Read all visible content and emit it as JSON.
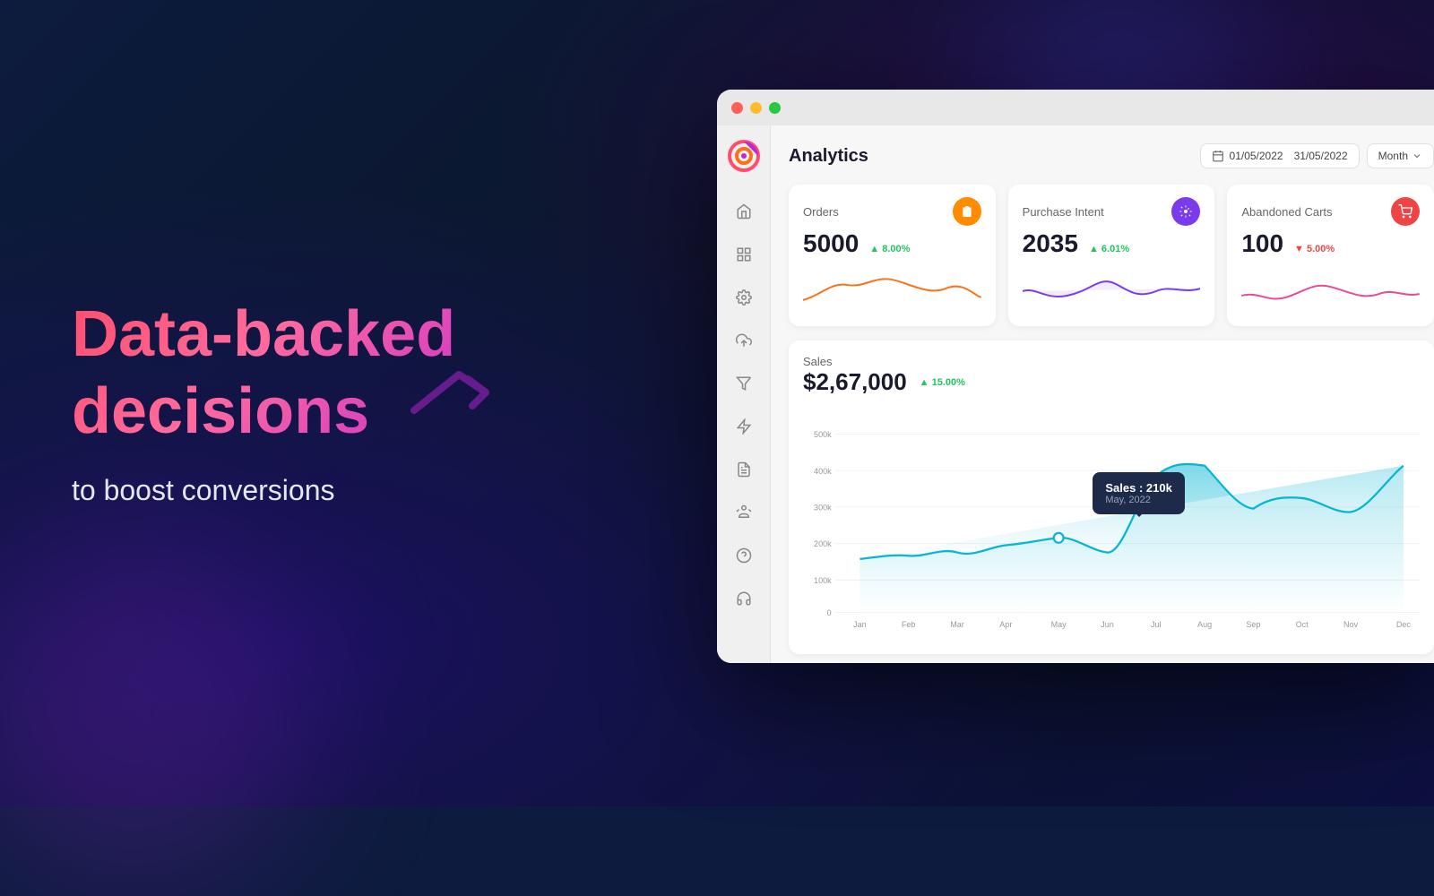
{
  "background": {
    "primary": "#0d1b3e",
    "secondary": "#0a1628"
  },
  "left_panel": {
    "headline_line1": "Data-backed",
    "headline_line2": "decisions",
    "subtitle": "to boost conversions"
  },
  "browser": {
    "title_bar": {
      "traffic_lights": [
        "red",
        "yellow",
        "green"
      ]
    },
    "header": {
      "page_title": "Analytics",
      "date_start": "01/05/2022",
      "date_end": "31/05/2022",
      "period_label": "Month"
    },
    "metrics": [
      {
        "label": "Orders",
        "value": "5000",
        "change": "8.00%",
        "change_positive": true,
        "icon": "clipboard-icon",
        "icon_class": "icon-orange"
      },
      {
        "label": "Purchase Intent",
        "value": "2035",
        "change": "6.01%",
        "change_positive": true,
        "icon": "target-icon",
        "icon_class": "icon-purple"
      },
      {
        "label": "Abandoned Carts",
        "value": "100",
        "change": "5.00%",
        "change_positive": false,
        "icon": "cart-icon",
        "icon_class": "icon-red"
      }
    ],
    "sales_chart": {
      "label": "Sales",
      "value": "$2,67,000",
      "change": "15.00%",
      "change_positive": true,
      "tooltip": {
        "title": "Sales : 210k",
        "subtitle": "May, 2022"
      },
      "y_axis": [
        "500k",
        "400k",
        "300k",
        "200k",
        "100k",
        "0"
      ],
      "x_axis": [
        "Jan",
        "Feb",
        "Mar",
        "Apr",
        "May",
        "Jun",
        "Jul",
        "Aug",
        "Sep",
        "Oct",
        "Nov",
        "Dec"
      ],
      "data_points": [
        150,
        160,
        170,
        190,
        210,
        170,
        380,
        410,
        290,
        320,
        280,
        410
      ]
    },
    "sidebar_icons": [
      {
        "name": "home-icon",
        "symbol": "⌂"
      },
      {
        "name": "layout-icon",
        "symbol": "▦"
      },
      {
        "name": "settings-icon",
        "symbol": "⚙"
      },
      {
        "name": "upload-icon",
        "symbol": "↑"
      },
      {
        "name": "megaphone-icon",
        "symbol": "📢"
      },
      {
        "name": "lightning-icon",
        "symbol": "⚡"
      },
      {
        "name": "document-icon",
        "symbol": "📄"
      },
      {
        "name": "person-icon",
        "symbol": "✿"
      },
      {
        "name": "help-icon",
        "symbol": "?"
      },
      {
        "name": "headset-icon",
        "symbol": "🎧"
      }
    ]
  }
}
